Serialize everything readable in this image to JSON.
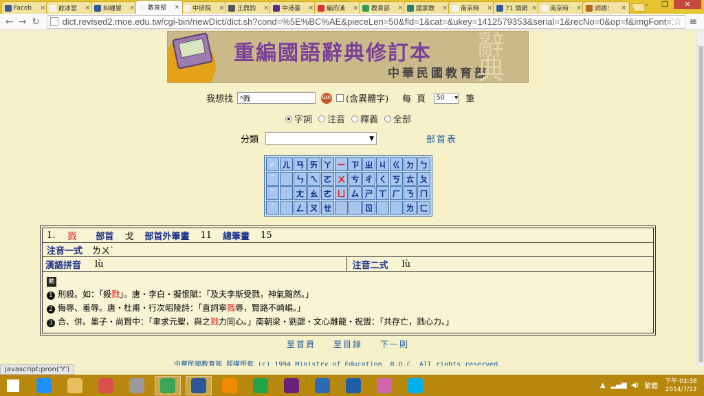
{
  "browser": {
    "tabs": [
      {
        "label": "Faceb",
        "color": "#3b5998"
      },
      {
        "label": "飲冰宮",
        "color": "#f5f5f5"
      },
      {
        "label": "糾纏冒",
        "color": "#2c5aa0"
      },
      {
        "label": "教育部",
        "color": "#f5f5f5",
        "active": true
      },
      {
        "label": "中研院",
        "color": "#f5f5f5"
      },
      {
        "label": "王鼎鈞",
        "color": "#555555"
      },
      {
        "label": "中港臺",
        "color": "#5c2d91"
      },
      {
        "label": "編的漢",
        "color": "#d33"
      },
      {
        "label": "教育部",
        "color": "#2a9d5a"
      },
      {
        "label": "國家教",
        "color": "#2a7d6a"
      },
      {
        "label": "南京時",
        "color": "#f5f5f5"
      },
      {
        "label": "71 個網",
        "color": "#2c5aa0"
      },
      {
        "label": "南京時",
        "color": "#f5f5f5"
      },
      {
        "label": "詞語：",
        "color": "#b06a1a"
      }
    ],
    "url": "dict.revised2.moe.edu.tw/cgi-bin/newDict/dict.sh?cond=%5E%BC%AE&pieceLen=50&fld=1&cat=&ukey=1412579353&serial=1&recNo=0&op=f&imgFont=1",
    "status_text": "javascript:pron('Y')"
  },
  "banner": {
    "title": "重編國語辭典修訂本",
    "subtitle": "中華民國教育部",
    "watermark": "辭典"
  },
  "search": {
    "label": "我想找",
    "value": "^戮",
    "go_label": "GO!",
    "variant_label": "(含異體字)",
    "per_page_label": "每頁",
    "per_page_value": "50",
    "unit_label": "筆"
  },
  "modes": [
    {
      "label": "字詞",
      "checked": true
    },
    {
      "label": "注音",
      "checked": false
    },
    {
      "label": "釋義",
      "checked": false
    },
    {
      "label": "全部",
      "checked": false
    }
  ],
  "category": {
    "label": "分類",
    "value": "",
    "radical_link": "部首表"
  },
  "zhuyin_keys": [
    [
      {
        "k": "✓",
        "c": "ctl"
      },
      {
        "k": "ㄦ"
      },
      {
        "k": "ㄢ"
      },
      {
        "k": "ㄞ"
      },
      {
        "k": "ㄚ"
      },
      {
        "k": "ㄧ",
        "c": "red"
      },
      {
        "k": "ㄗ"
      },
      {
        "k": "ㄓ"
      },
      {
        "k": "ㄐ"
      },
      {
        "k": "ㄍ"
      },
      {
        "k": "ㄉ"
      },
      {
        "k": "ㄅ"
      }
    ],
    [
      {
        "k": "ˇ",
        "c": "ctl"
      },
      {
        "k": ""
      },
      {
        "k": "ㄣ"
      },
      {
        "k": "ㄟ"
      },
      {
        "k": "ㄛ"
      },
      {
        "k": "ㄨ",
        "c": "red"
      },
      {
        "k": "ㄘ"
      },
      {
        "k": "ㄔ"
      },
      {
        "k": "ㄑ"
      },
      {
        "k": "ㄎ"
      },
      {
        "k": "ㄊ"
      },
      {
        "k": "ㄆ"
      }
    ],
    [
      {
        "k": "ˋ",
        "c": "ctl"
      },
      {
        "k": ""
      },
      {
        "k": "ㄤ"
      },
      {
        "k": "ㄠ"
      },
      {
        "k": "ㄜ"
      },
      {
        "k": "ㄩ",
        "c": "red"
      },
      {
        "k": "ㄙ"
      },
      {
        "k": "ㄕ"
      },
      {
        "k": "ㄒ"
      },
      {
        "k": "ㄏ"
      },
      {
        "k": "ㄋ"
      },
      {
        "k": "ㄇ"
      }
    ],
    [
      {
        "k": "˙",
        "c": "ctl"
      },
      {
        "k": ""
      },
      {
        "k": "ㄥ"
      },
      {
        "k": "ㄡ"
      },
      {
        "k": "ㄝ"
      },
      {
        "k": ""
      },
      {
        "k": ""
      },
      {
        "k": "ㄖ"
      },
      {
        "k": ""
      },
      {
        "k": ""
      },
      {
        "k": "ㄌ"
      },
      {
        "k": "ㄈ"
      }
    ]
  ],
  "entry": {
    "index": "1.",
    "char": "戮",
    "radical_label": "部首",
    "radical": "戈",
    "extra_strokes_label": "部首外筆畫",
    "extra_strokes": "11",
    "total_strokes_label": "總筆畫",
    "total_strokes": "15",
    "zhuyin1_label": "注音一式",
    "zhuyin1": "ㄌㄨˋ",
    "pinyin_label": "漢語拼音",
    "pinyin": "lù",
    "zhuyin2_label": "注音二式",
    "zhuyin2": "lù",
    "pos_tag": "動",
    "definitions": [
      {
        "num": "1",
        "pre": "刑殺。如：「殺",
        "hl": "戮",
        "post": "」。唐‧李白‧擬恨賦：「及夫李斯受戮，神氣黯然。」"
      },
      {
        "num": "2",
        "pre": "侮辱、羞辱。唐‧杜甫‧行次昭陵詩：「直詞寧",
        "hl": "戮",
        "post": "辱，賢路不崎嶇。」"
      },
      {
        "num": "3",
        "pre": "合、併。墨子‧尚賢中：「聿求元聖，與之",
        "hl": "戮",
        "post": "力同心。」南朝梁‧劉勰‧文心雕龍‧祝盟：「共存亡，戮心力。」"
      }
    ]
  },
  "footer": {
    "links": [
      "至首頁",
      "至目錄",
      "下一則"
    ],
    "copyright": "中華民國教育部  版權所有  (c) 1994 Ministry of Education, R.O.C. All rights reserved."
  },
  "taskbar": {
    "apps": [
      {
        "name": "windows-start",
        "color": "#ffffff"
      },
      {
        "name": "internet-explorer",
        "color": "#1e90ff"
      },
      {
        "name": "file-explorer",
        "color": "#e8c060"
      },
      {
        "name": "picasa",
        "color": "#d8504a"
      },
      {
        "name": "app-gray",
        "color": "#999999"
      },
      {
        "name": "chrome",
        "color": "#3aa757",
        "active": true
      },
      {
        "name": "word",
        "color": "#2b579a",
        "active": true
      },
      {
        "name": "orange-app",
        "color": "#f08a00"
      },
      {
        "name": "store",
        "color": "#22a34a"
      },
      {
        "name": "visual-studio",
        "color": "#68217a"
      },
      {
        "name": "globe-app",
        "color": "#2a6ab8"
      },
      {
        "name": "lync",
        "color": "#1f5fa8"
      },
      {
        "name": "pink-app",
        "color": "#d066b0"
      },
      {
        "name": "skype",
        "color": "#00aff0"
      }
    ],
    "ime": "繁體",
    "time": "下午 03:38",
    "date": "2014/7/12"
  }
}
